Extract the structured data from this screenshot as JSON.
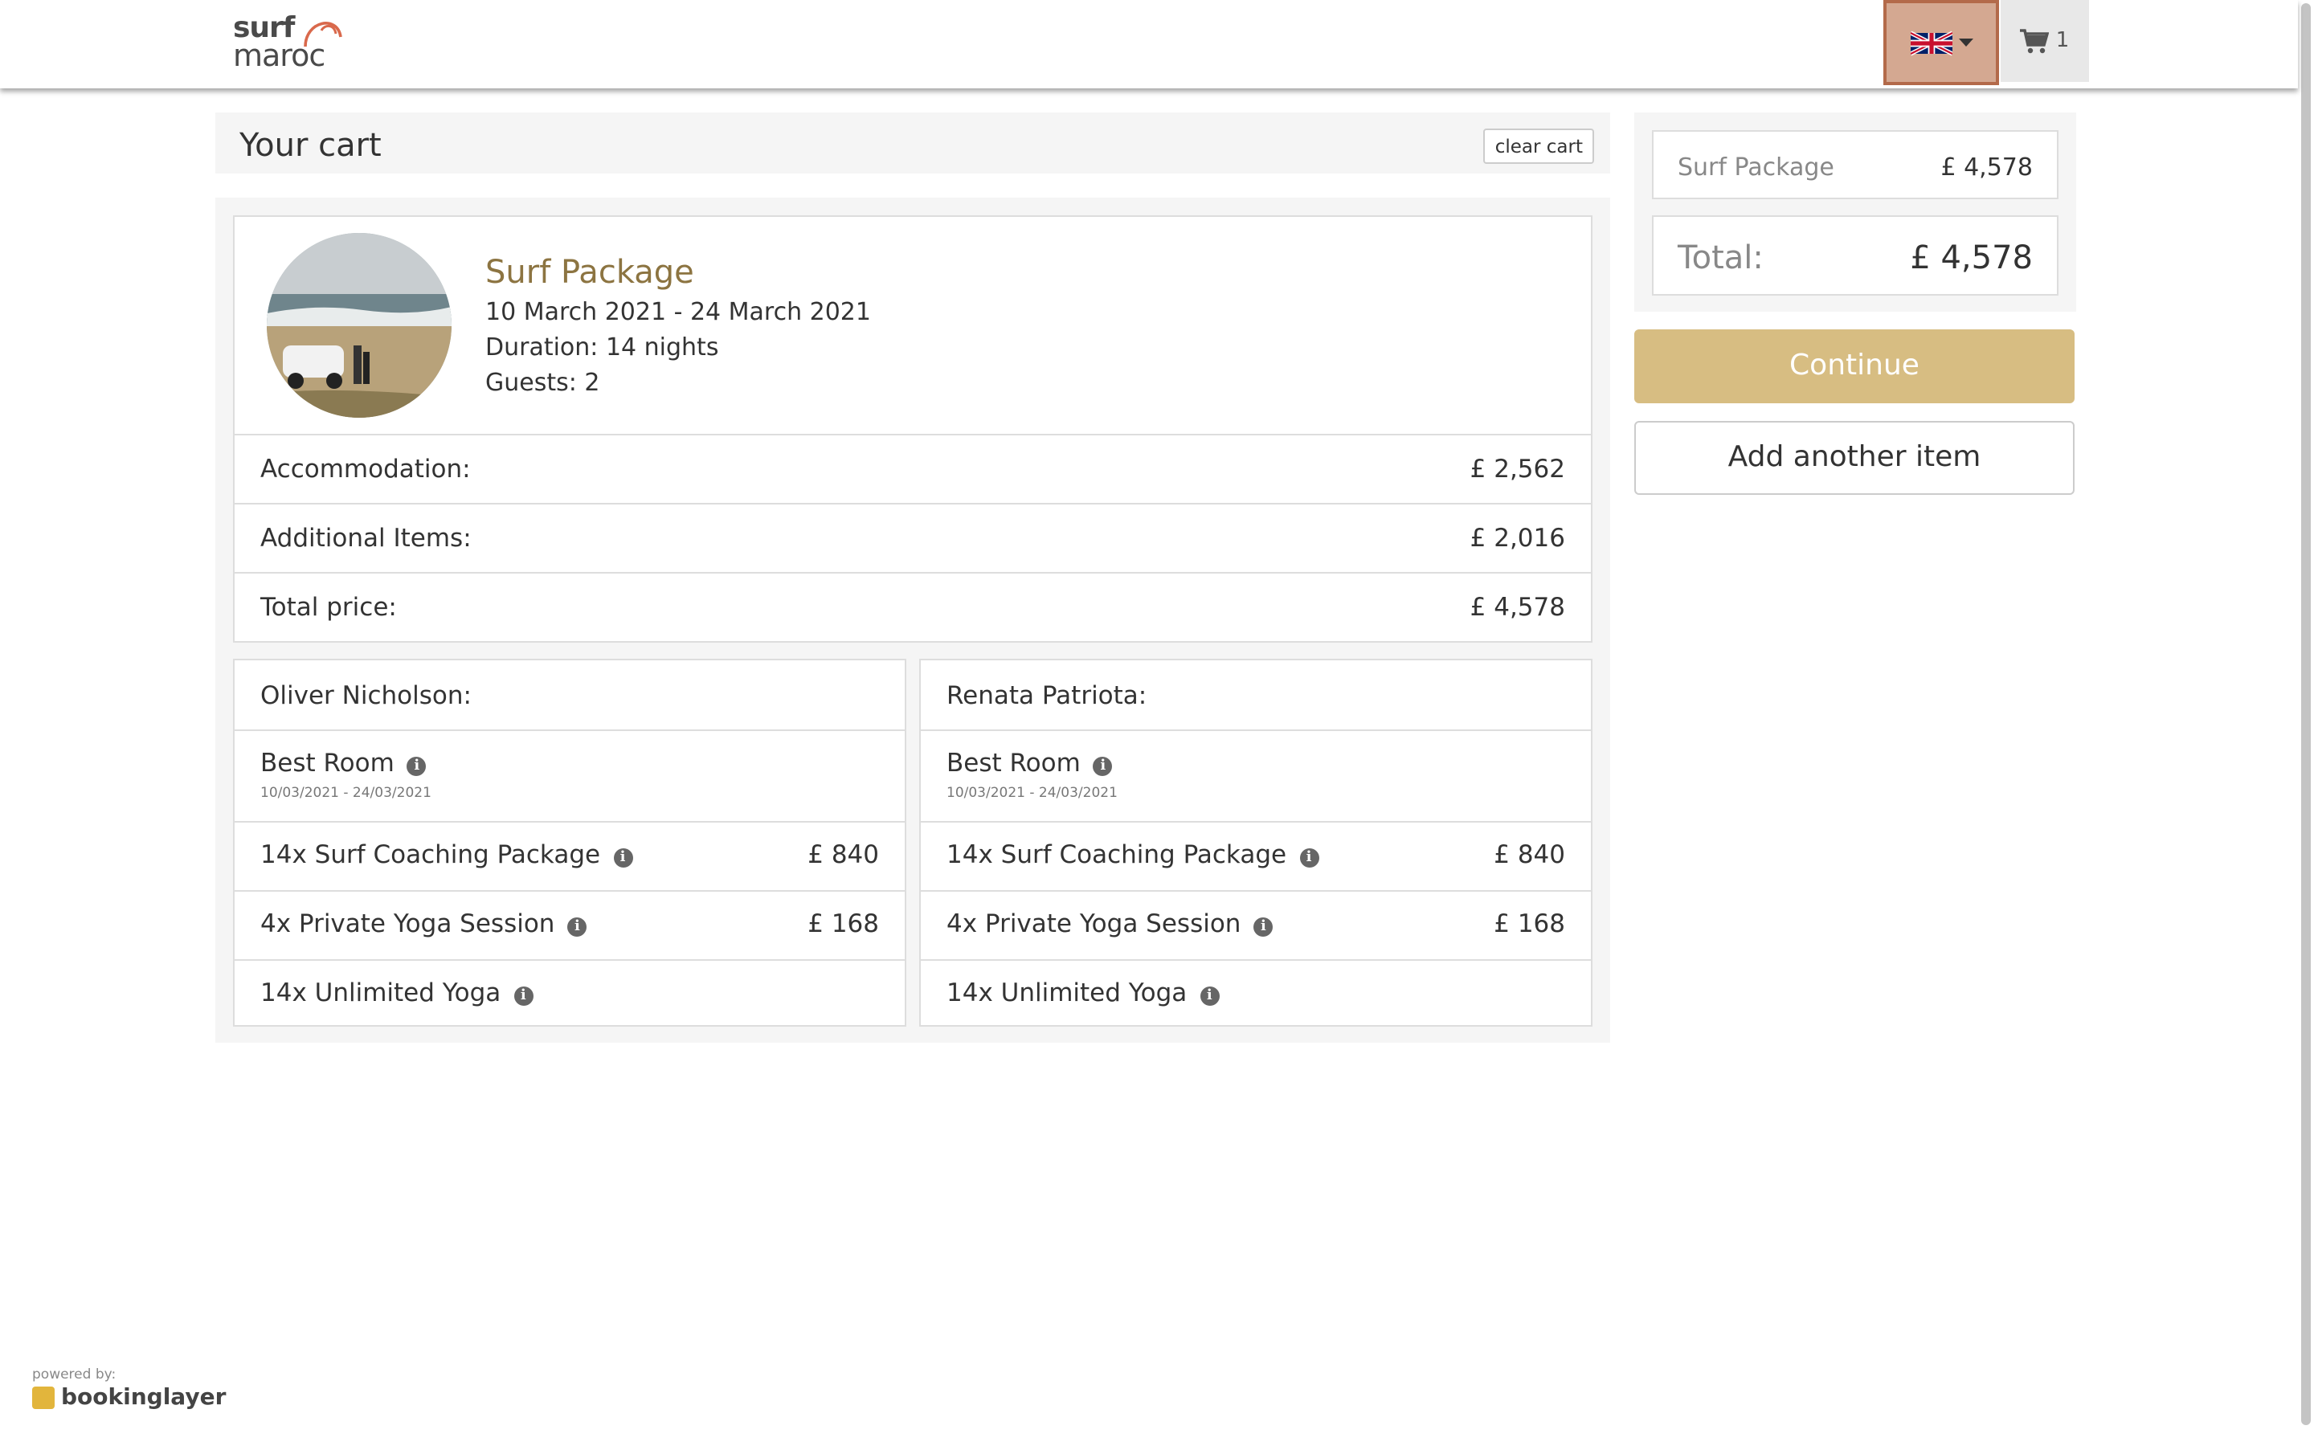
{
  "header": {
    "logo_line1": "surf",
    "logo_line2": "maroc",
    "cart_count": "1"
  },
  "cart": {
    "title": "Your cart",
    "clear_label": "clear cart",
    "item": {
      "title": "Surf Package",
      "dates": "10 March 2021 - 24 March 2021",
      "duration": "Duration: 14 nights",
      "guests": "Guests: 2",
      "rows": [
        {
          "label": "Accommodation:",
          "value": "£ 2,562"
        },
        {
          "label": "Additional Items:",
          "value": "£ 2,016"
        },
        {
          "label": "Total price:",
          "value": "£ 4,578"
        }
      ]
    },
    "guests": [
      {
        "name": "Oliver Nicholson:",
        "room": "Best Room",
        "room_dates": "10/03/2021 - 24/03/2021",
        "extras": [
          {
            "label": "14x Surf Coaching Package",
            "value": "£ 840"
          },
          {
            "label": "4x Private Yoga Session",
            "value": "£ 168"
          },
          {
            "label": "14x Unlimited Yoga",
            "value": ""
          }
        ]
      },
      {
        "name": "Renata Patriota:",
        "room": "Best Room",
        "room_dates": "10/03/2021 - 24/03/2021",
        "extras": [
          {
            "label": "14x Surf Coaching Package",
            "value": "£ 840"
          },
          {
            "label": "4x Private Yoga Session",
            "value": "£ 168"
          },
          {
            "label": "14x Unlimited Yoga",
            "value": ""
          }
        ]
      }
    ]
  },
  "summary": {
    "item_label": "Surf Package",
    "item_value": "£ 4,578",
    "total_label": "Total:",
    "total_value": "£ 4,578",
    "continue_label": "Continue",
    "add_label": "Add another item"
  },
  "footer": {
    "powered_by": "powered by:",
    "brand": "bookinglayer"
  },
  "colors": {
    "accent": "#d7bd82",
    "title_gold": "#8c7441",
    "lang_button": "#d4a891"
  }
}
